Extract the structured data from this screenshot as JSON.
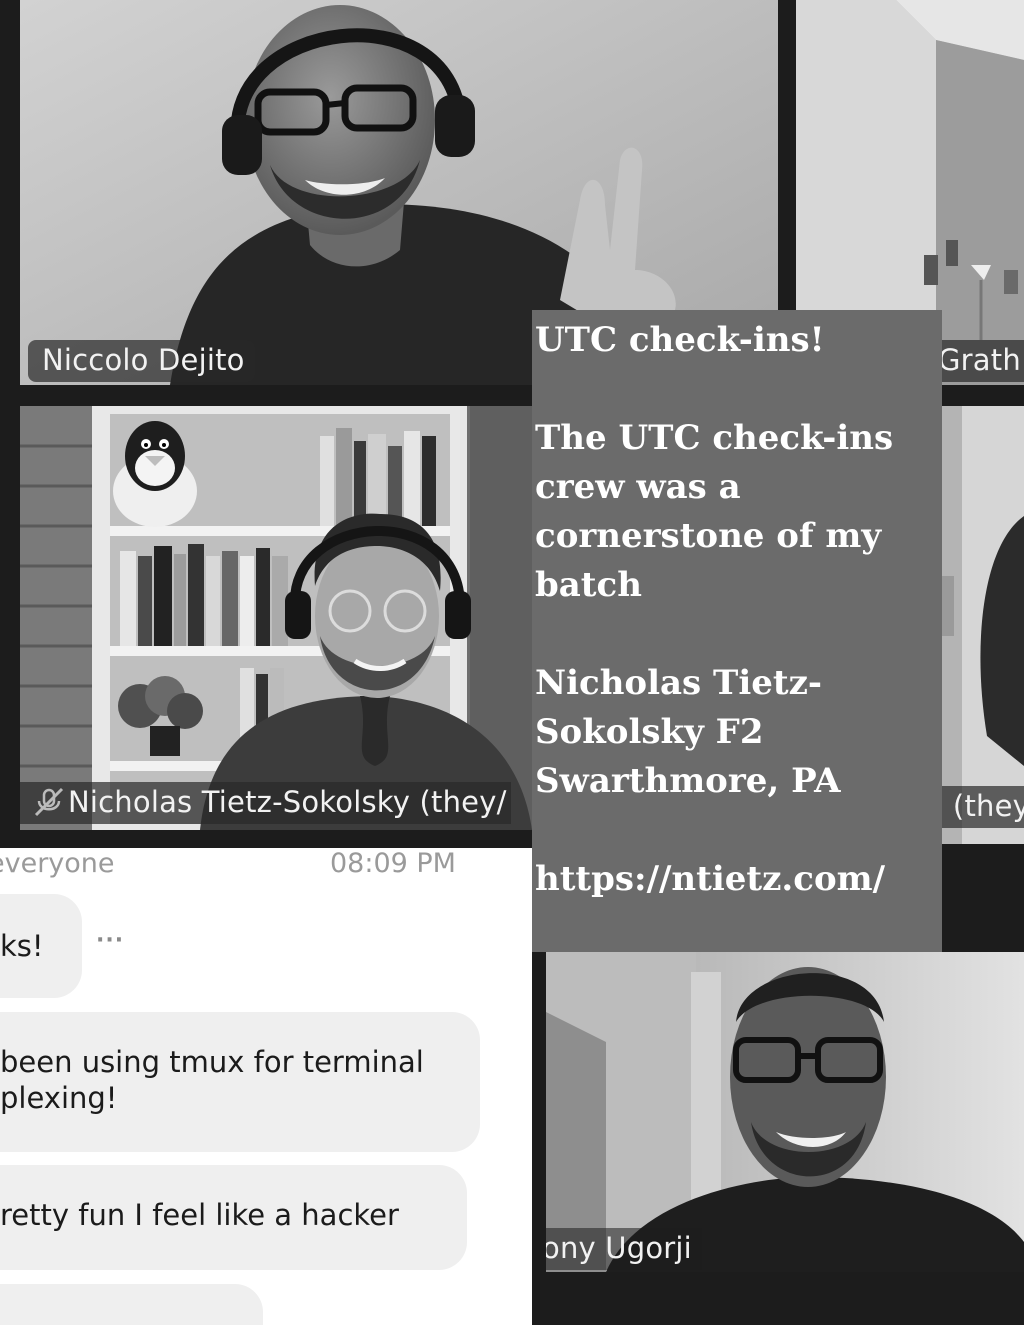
{
  "participants": [
    {
      "name": "Niccolo Dejito"
    },
    {
      "name": "Nicholas Tietz-Sokolsky (they/"
    },
    {
      "name": "Grath"
    },
    {
      "name": ") (they"
    },
    {
      "name": "ony Ugorji"
    }
  ],
  "chat": {
    "to_label": "everyone",
    "time": "08:09 PM",
    "more_label": "···",
    "messages": [
      {
        "lines": [
          "ks!"
        ]
      },
      {
        "lines": [
          "been using tmux for terminal",
          "plexing!"
        ]
      },
      {
        "lines": [
          "retty fun I feel like a hacker"
        ]
      },
      {
        "lines": [
          ""
        ]
      }
    ]
  },
  "overlay": {
    "title": "UTC check-ins!",
    "quote_lines": [
      "The UTC check-ins",
      "crew was a",
      "cornerstone of my",
      "batch"
    ],
    "author_lines": [
      "Nicholas Tietz-",
      "Sokolsky F2",
      "Swarthmore, PA"
    ],
    "url": "https://ntietz.com/"
  },
  "colors": {
    "overlay_bg": "#6b6b6b",
    "tile_border": "#1c1c1c",
    "chat_bg": "#ffffff",
    "bubble_bg": "#efefef"
  }
}
